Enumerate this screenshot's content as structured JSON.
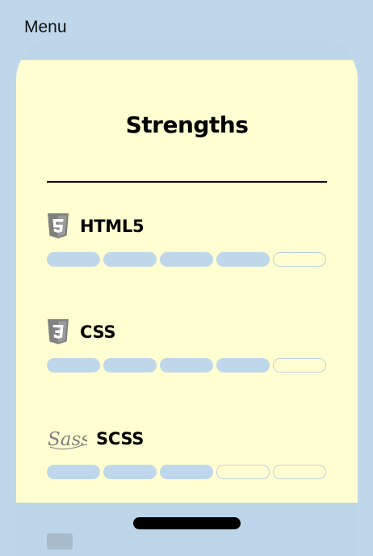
{
  "menu_label": "Menu",
  "title": "Strengths",
  "skills": [
    {
      "name": "HTML5",
      "icon": "html5-icon",
      "level": 4,
      "max": 5
    },
    {
      "name": "CSS",
      "icon": "css3-icon",
      "level": 4,
      "max": 5
    },
    {
      "name": "SCSS",
      "icon": "sass-icon",
      "level": 3,
      "max": 5
    }
  ],
  "colors": {
    "page_background": "#bfd7ea",
    "card_background": "#ffffd1",
    "bar_filled": "#bfd7ea",
    "bar_empty_border": "#bcd2e2",
    "icon_gray": "#808080"
  }
}
